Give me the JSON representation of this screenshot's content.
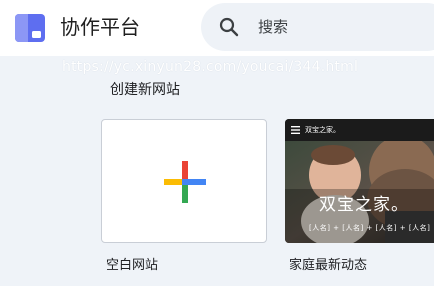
{
  "app": {
    "title": "协作平台",
    "logo_icon": "sites-logo-icon",
    "logo_color": "#5e6ef0"
  },
  "search": {
    "icon": "search-icon",
    "placeholder": "搜索"
  },
  "watermark": "https://yc.xinyun28.com/youcai/344.html",
  "section": {
    "title": "创建新网站"
  },
  "cards": [
    {
      "label": "空白网站",
      "icon": "plus-icon",
      "colors": [
        "#ea4335",
        "#4285f4",
        "#34a853",
        "#fbbc04"
      ]
    },
    {
      "label": "家庭最新动态",
      "preview": {
        "menu_icon": "menu-icon",
        "site_name": "双宝之家。",
        "heading": "双宝之家。",
        "names": "[人名] + [人名] + [人名] + [人名]"
      }
    }
  ]
}
